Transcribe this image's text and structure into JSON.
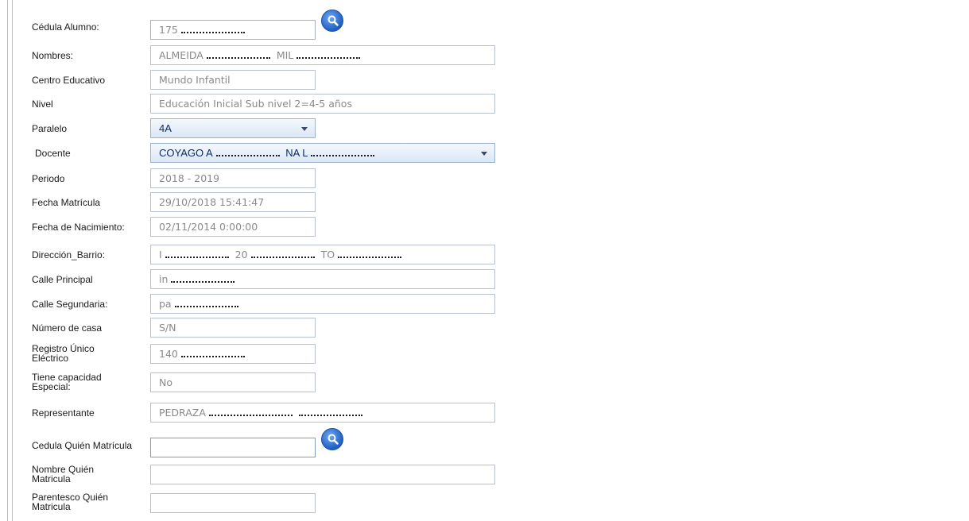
{
  "form": {
    "cedula_alumno": {
      "label": "Cédula Alumno:",
      "value": "175"
    },
    "nombres": {
      "label": "Nombres:",
      "value_a": "ALMEIDA",
      "value_b": "MIL"
    },
    "centro_educativo": {
      "label": "Centro Educativo",
      "value": "Mundo Infantil"
    },
    "nivel": {
      "label": "Nivel",
      "value": "Educación Inicial Sub nivel 2=4-5 años"
    },
    "paralelo": {
      "label": "Paralelo",
      "value": "4A"
    },
    "docente": {
      "label": "Docente",
      "value_a": "COYAGO A",
      "value_b": "NA L"
    },
    "periodo": {
      "label": "Periodo",
      "value": "2018 - 2019"
    },
    "fecha_matricula": {
      "label": "Fecha Matrícula",
      "value": "29/10/2018 15:41:47"
    },
    "fecha_nacimiento": {
      "label": "Fecha de Nacimiento:",
      "value": "02/11/2014 0:00:00"
    },
    "direccion_barrio": {
      "label": "Dirección_Barrio:",
      "value_a": "I",
      "value_b": "20",
      "value_c": "TO"
    },
    "calle_principal": {
      "label": "Calle Principal",
      "value": "in"
    },
    "calle_segundaria": {
      "label": "Calle Segundaria:",
      "value": "pa"
    },
    "numero_casa": {
      "label": "Número de casa",
      "value": "S/N"
    },
    "registro_unico": {
      "label": "Registro Único Eléctrico",
      "value": "140"
    },
    "capacidad_especial": {
      "label": "Tiene capacidad Especial:",
      "value": "No"
    },
    "representante": {
      "label": "Representante",
      "value": "PEDRAZA"
    },
    "cedula_quien": {
      "label": "Cedula Quién Matrícula",
      "value": ""
    },
    "nombre_quien": {
      "label": "Nombre Quién Matricula",
      "value": ""
    },
    "parentesco_quien": {
      "label": "Parentesco Quién Matricula",
      "value": ""
    }
  },
  "icons": {
    "search": "search-icon"
  },
  "colors": {
    "accent": "#1f5fc4",
    "border": "#b8c1cc",
    "select_text": "#102a63"
  }
}
